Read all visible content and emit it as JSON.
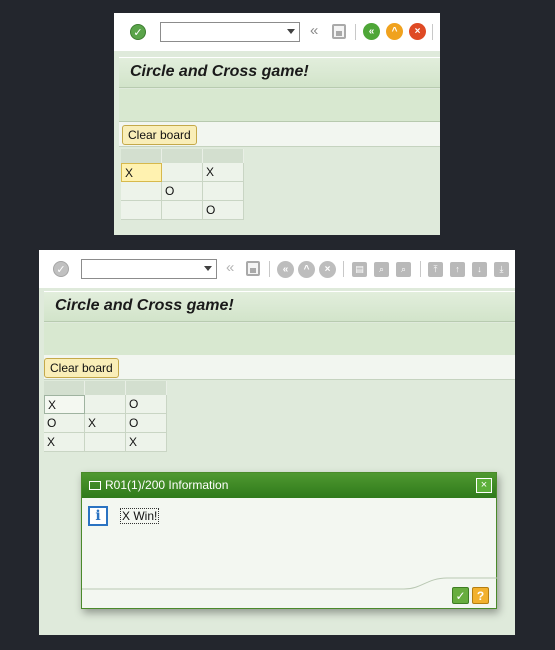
{
  "screen1": {
    "title": "Circle and Cross game!",
    "clear_label": "Clear board",
    "board": [
      [
        "X",
        "",
        "X"
      ],
      [
        "",
        "O",
        ""
      ],
      [
        "",
        "",
        "O"
      ]
    ]
  },
  "screen2": {
    "title": "Circle and Cross game!",
    "clear_label": "Clear board",
    "board": [
      [
        "X",
        "",
        "O"
      ],
      [
        "O",
        "X",
        "O"
      ],
      [
        "X",
        "",
        "X"
      ]
    ],
    "dialog": {
      "title": "R01(1)/200 Information",
      "message": "X Win!"
    }
  },
  "icons": {
    "enter": "check-circle-icon",
    "back": "green-back-icon",
    "exit": "orange-exit-icon",
    "cancel": "red-cancel-icon",
    "info": "info-icon",
    "confirm": "check-icon",
    "help": "help-icon"
  },
  "colors": {
    "background": "#23262d",
    "sap_green": "#4f9830",
    "selected_cell": "#fff2b0",
    "button_yellow": "#f9eeb8"
  }
}
